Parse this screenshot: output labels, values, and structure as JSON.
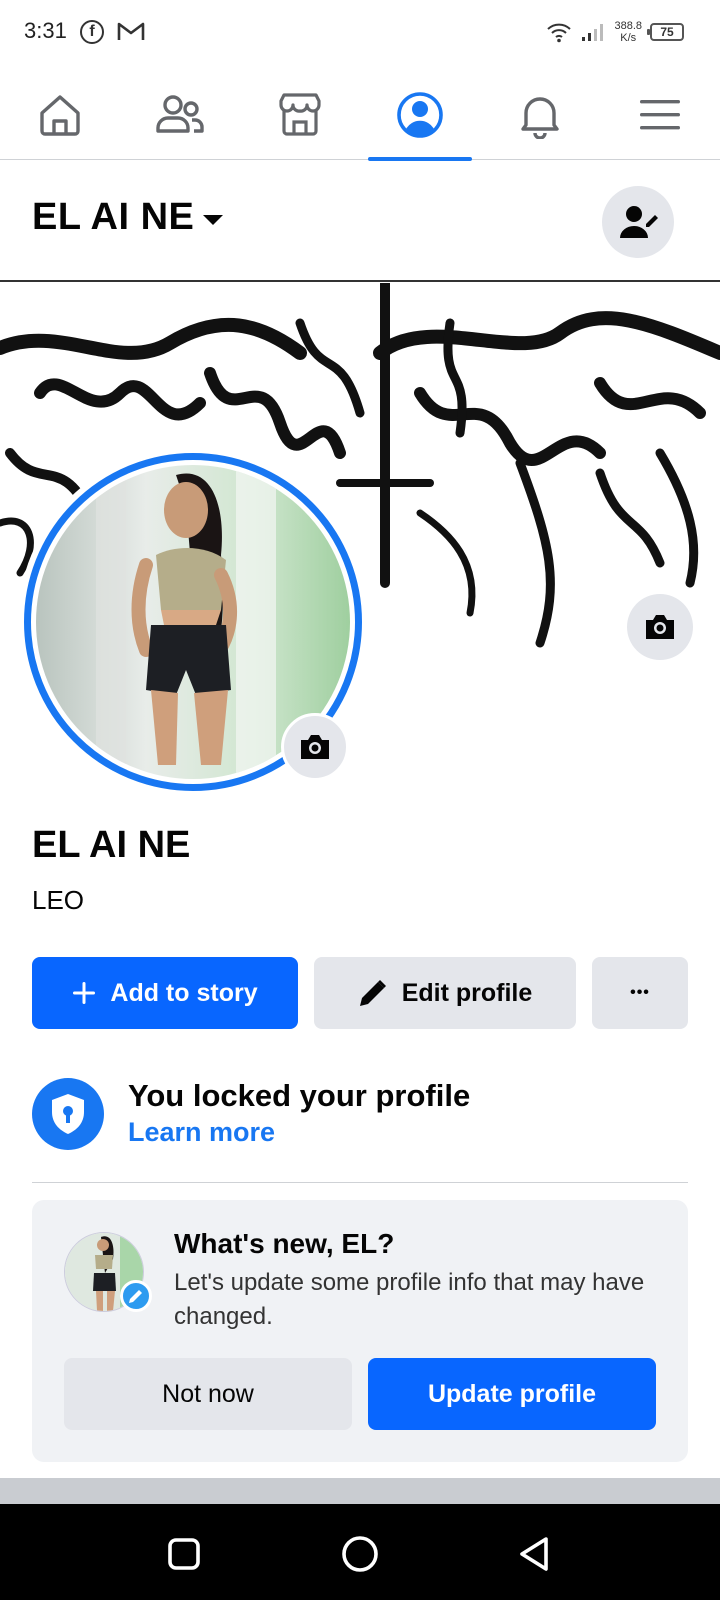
{
  "status_bar": {
    "time": "3:31",
    "network_speed_value": "388.8",
    "network_speed_unit": "K/s",
    "battery": "75"
  },
  "nav": {
    "items": [
      {
        "name": "home",
        "icon": "home-icon"
      },
      {
        "name": "friends",
        "icon": "friends-icon"
      },
      {
        "name": "marketplace",
        "icon": "marketplace-icon"
      },
      {
        "name": "profile",
        "icon": "profile-icon",
        "active": true
      },
      {
        "name": "notifications",
        "icon": "bell-icon"
      },
      {
        "name": "menu",
        "icon": "menu-icon"
      }
    ]
  },
  "header": {
    "name": "EL AI NE"
  },
  "profile": {
    "name": "EL AI NE",
    "bio": "LEO"
  },
  "actions": {
    "add_story": "Add to story",
    "edit_profile": "Edit profile",
    "more": "•••"
  },
  "lock_notice": {
    "title": "You locked your profile",
    "link": "Learn more"
  },
  "update_card": {
    "title": "What's new, EL?",
    "text": "Let's update some profile info that may have changed.",
    "dismiss": "Not now",
    "confirm": "Update profile"
  },
  "colors": {
    "brand_blue": "#1877f2",
    "button_blue": "#0866ff",
    "button_gray": "#e4e6eb"
  }
}
